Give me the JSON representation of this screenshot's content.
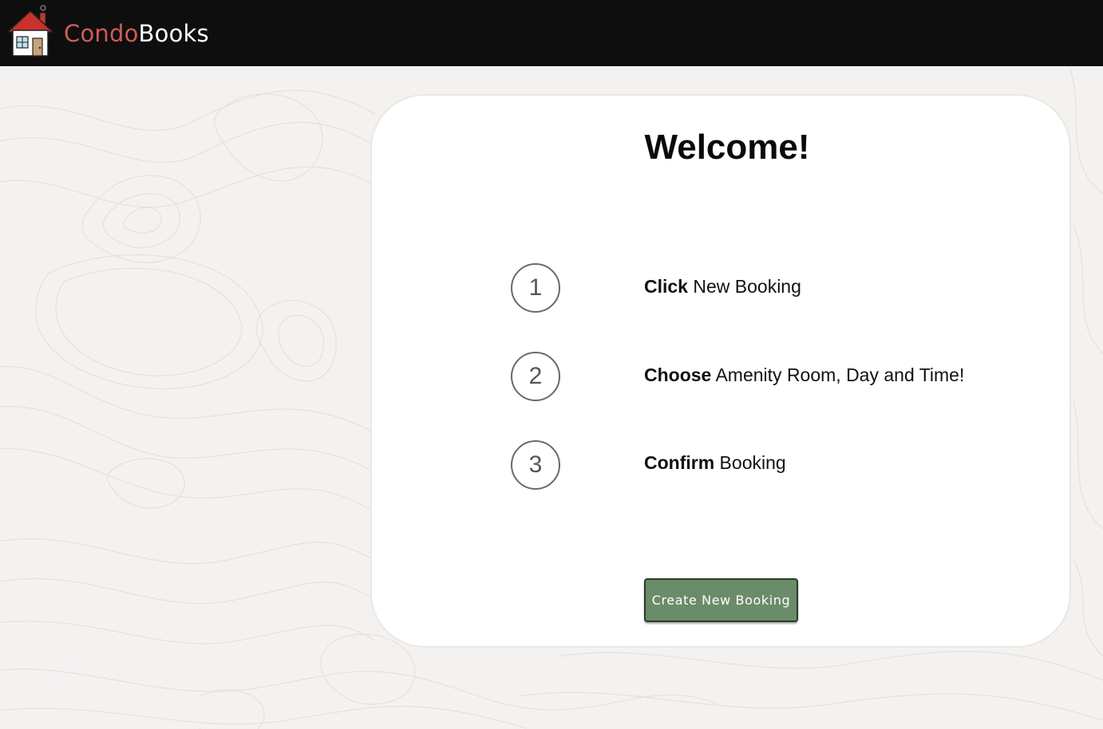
{
  "navbar": {
    "brand_part1": "Condo",
    "brand_part2": "Books",
    "logo_icon": "house-icon",
    "brand_color": "#cf5b58"
  },
  "main": {
    "heading": "Welcome!",
    "steps": [
      {
        "number": "1",
        "bold": "Click",
        "rest": " New Booking"
      },
      {
        "number": "2",
        "bold": "Choose",
        "rest": " Amenity Room, Day and Time!"
      },
      {
        "number": "3",
        "bold": "Confirm",
        "rest": " Booking"
      }
    ],
    "create_button_label": "Create New Booking",
    "button_color": "#6a8c68"
  }
}
